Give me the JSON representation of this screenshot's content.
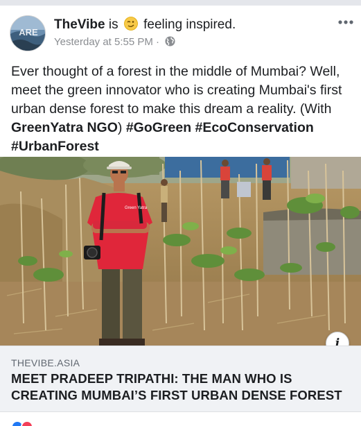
{
  "post": {
    "author": "TheVibe",
    "is_word": "is",
    "feeling": "feeling inspired.",
    "timestamp": "Yesterday at 5:55 PM",
    "separator": "·",
    "audience_icon": "globe-icon",
    "more_icon": "more-horizontal-icon",
    "text_intro": "Ever thought of a forest in the middle of Mumbai? Well, meet the green innovator who is creating Mumbai's first urban dense forest to make this dream a reality. (With ",
    "mention": "GreenYatra NGO",
    "text_close": ") ",
    "hashtags": [
      "#GoGreen",
      "#EcoConservation",
      "#UrbanForest"
    ]
  },
  "photo": {
    "shirt_logo": "Green Yatra"
  },
  "link": {
    "domain": "THEVIBE.ASIA",
    "title": "MEET PRADEEP TRIPATHI: THE MAN WHO IS CREATING MUMBAI’S FIRST URBAN DENSE FOREST",
    "info_label": "i"
  },
  "colors": {
    "text": "#1c1e21",
    "meta": "#8a8d91",
    "card_bg": "#f0f2f5",
    "shirt": "#e0263a"
  }
}
